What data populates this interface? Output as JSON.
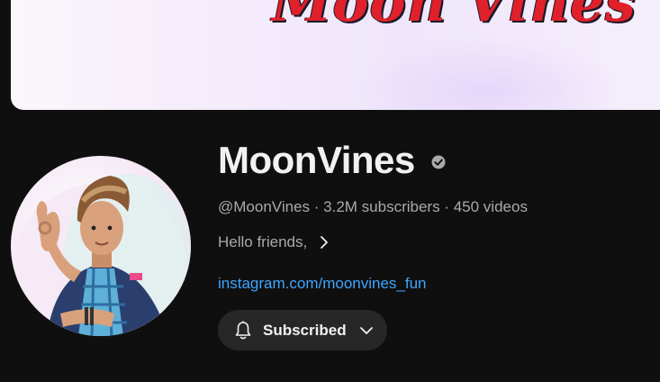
{
  "banner": {
    "title": "Moon Vines"
  },
  "channel": {
    "name": "MoonVines",
    "handle": "@MoonVines",
    "separator": "·",
    "subscribers": "3.2M subscribers",
    "videos": "450 videos",
    "description": "Hello friends,",
    "link": "instagram.com/moonvines_fun"
  },
  "subscribe_button": {
    "label": "Subscribed"
  },
  "icons": {
    "verified": "verified-check-icon",
    "description_expand": "chevron-right-icon",
    "bell": "bell-icon",
    "dropdown": "chevron-down-icon"
  },
  "colors": {
    "background": "#0f0f0f",
    "link": "#3ea6ff",
    "button_bg": "#272727",
    "banner_text": "#e0202a"
  }
}
